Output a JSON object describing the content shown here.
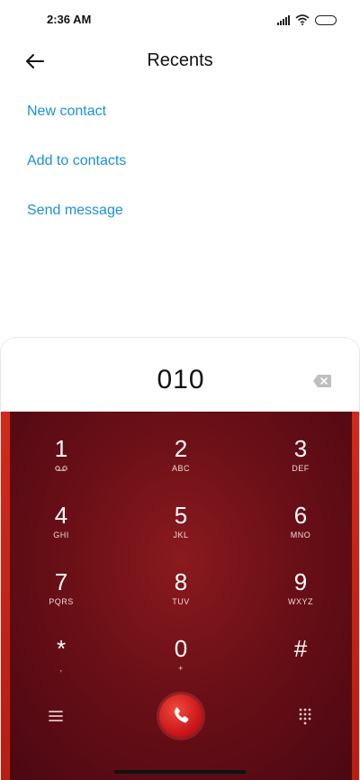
{
  "status_bar": {
    "time": "2:36 AM"
  },
  "header": {
    "title": "Recents",
    "back_icon": "arrow-left-icon"
  },
  "actions": [
    {
      "label": "New contact"
    },
    {
      "label": "Add to contacts"
    },
    {
      "label": "Send message"
    }
  ],
  "dialer": {
    "number": "010",
    "backspace_icon": "backspace-icon",
    "keys": [
      {
        "digit": "1",
        "letters": ""
      },
      {
        "digit": "2",
        "letters": "ABC"
      },
      {
        "digit": "3",
        "letters": "DEF"
      },
      {
        "digit": "4",
        "letters": "GHI"
      },
      {
        "digit": "5",
        "letters": "JKL"
      },
      {
        "digit": "6",
        "letters": "MNO"
      },
      {
        "digit": "7",
        "letters": "PQRS"
      },
      {
        "digit": "8",
        "letters": "TUV"
      },
      {
        "digit": "9",
        "letters": "WXYZ"
      },
      {
        "digit": "*",
        "letters": ","
      },
      {
        "digit": "0",
        "letters": "+"
      },
      {
        "digit": "#",
        "letters": ""
      }
    ],
    "menu_icon": "menu-icon",
    "call_icon": "phone-icon",
    "keypad_icon": "dialpad-icon"
  },
  "colors": {
    "link": "#1a8fe0",
    "keypad_bg": "#6a0f17",
    "call_button": "#d0141a"
  }
}
